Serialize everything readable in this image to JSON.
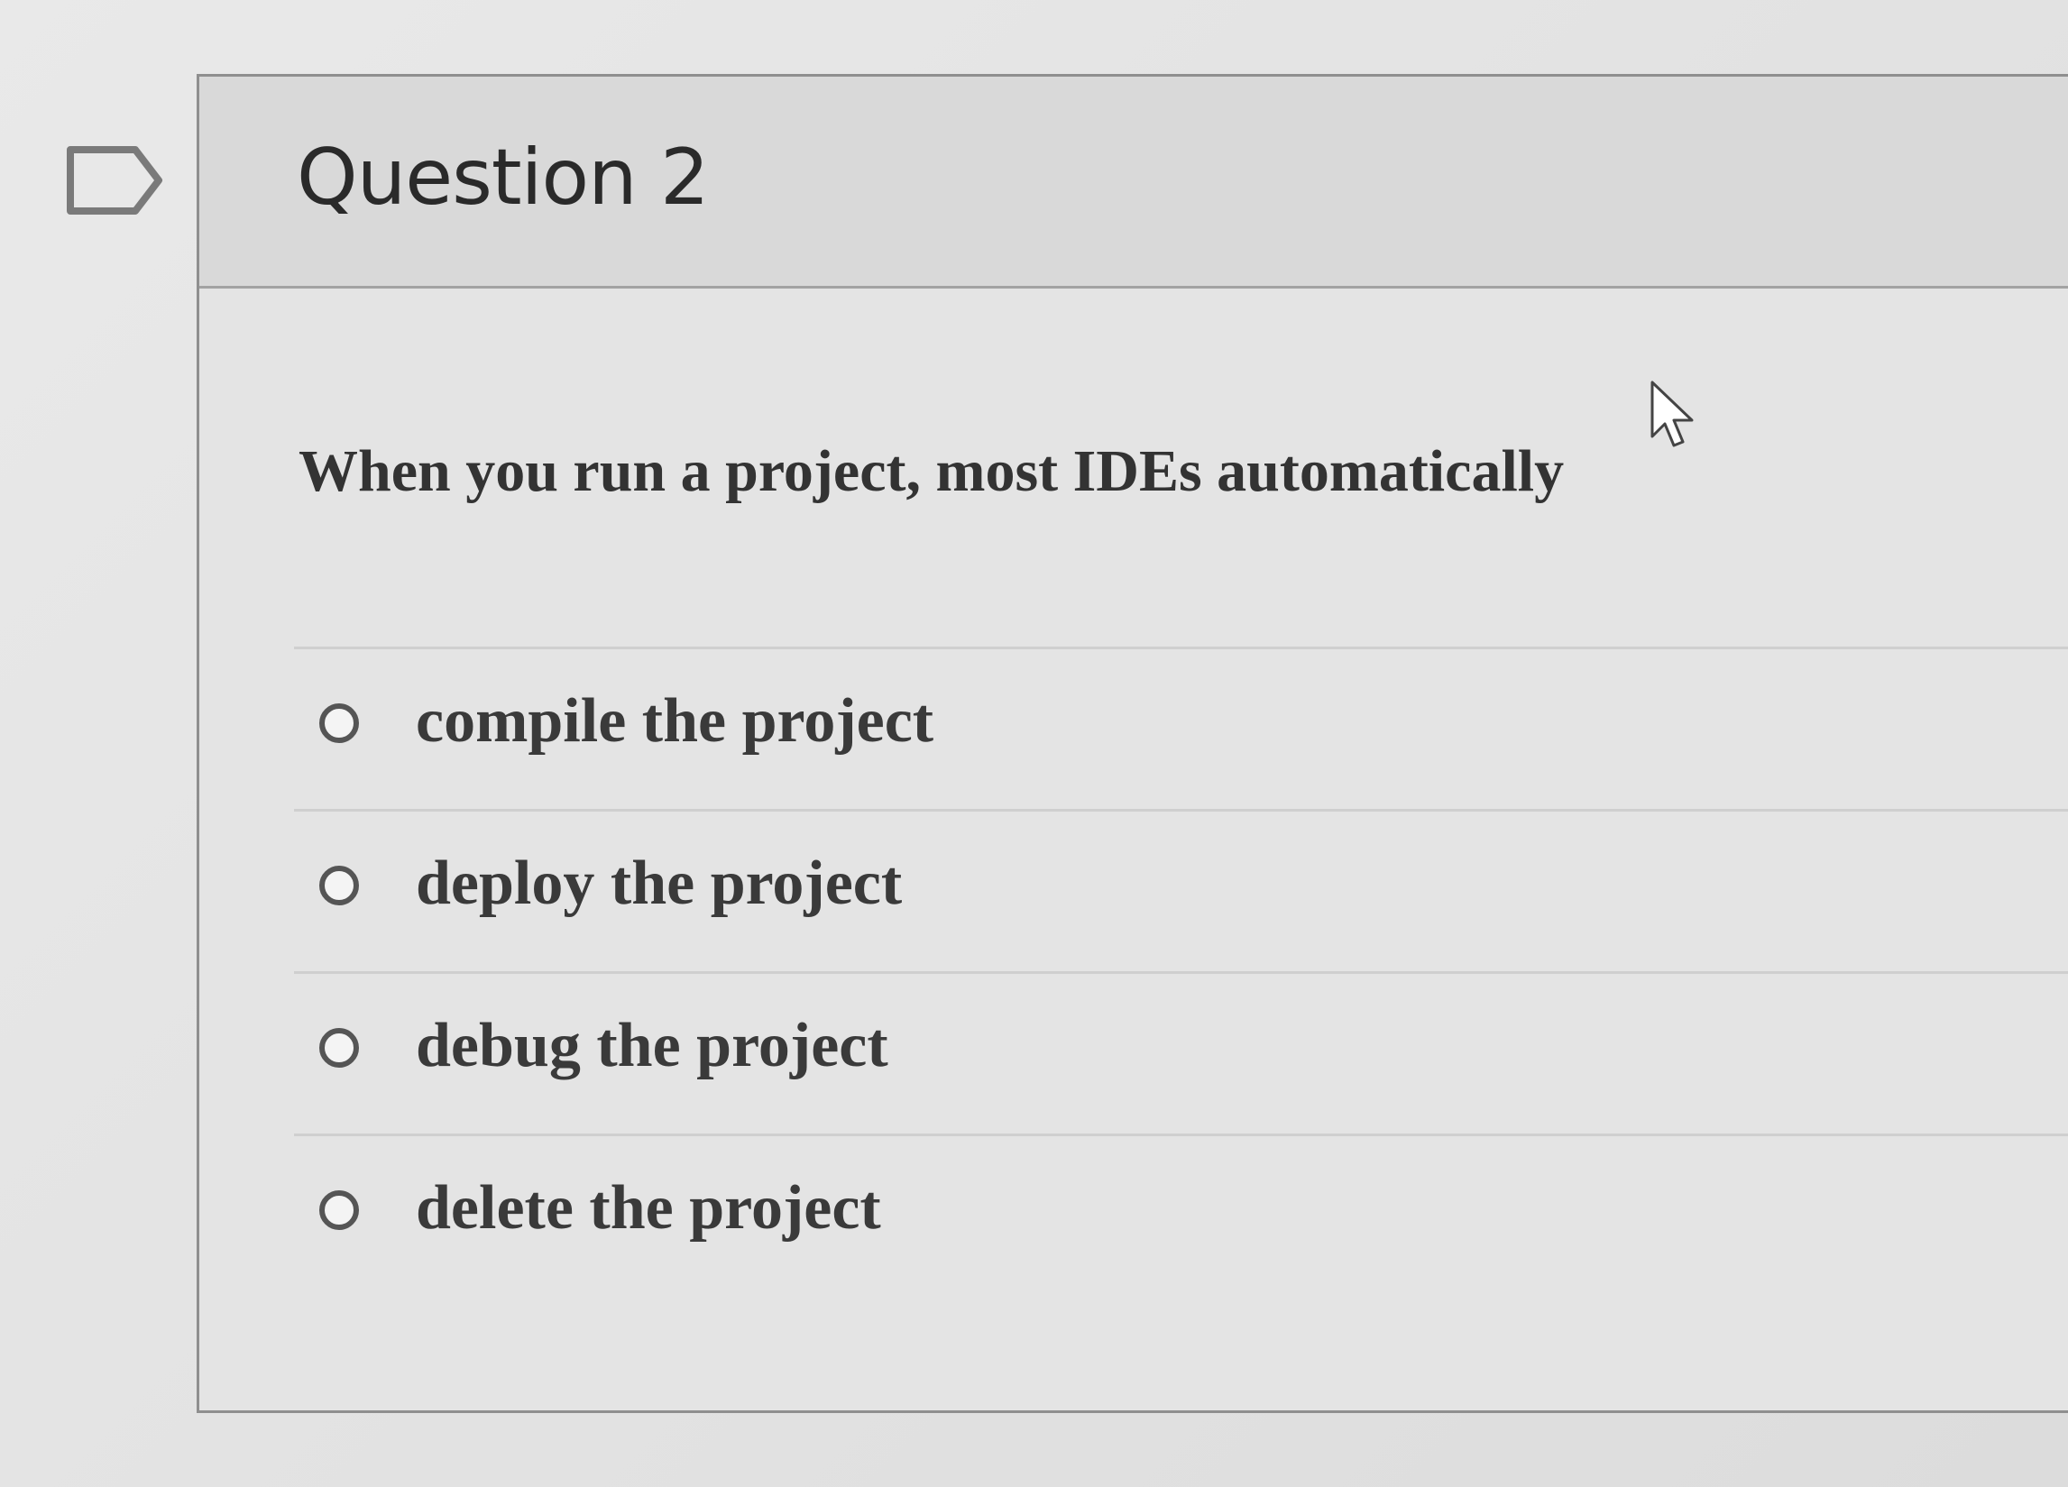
{
  "question": {
    "title": "Question 2",
    "prompt": "When you run a project, most IDEs automatically"
  },
  "answers": [
    {
      "label": "compile the project",
      "selected": false
    },
    {
      "label": "deploy the project",
      "selected": false
    },
    {
      "label": "debug the project",
      "selected": false
    },
    {
      "label": "delete the project",
      "selected": false
    }
  ],
  "icons": {
    "flag": "flag-icon",
    "cursor": "mouse-pointer-icon"
  }
}
